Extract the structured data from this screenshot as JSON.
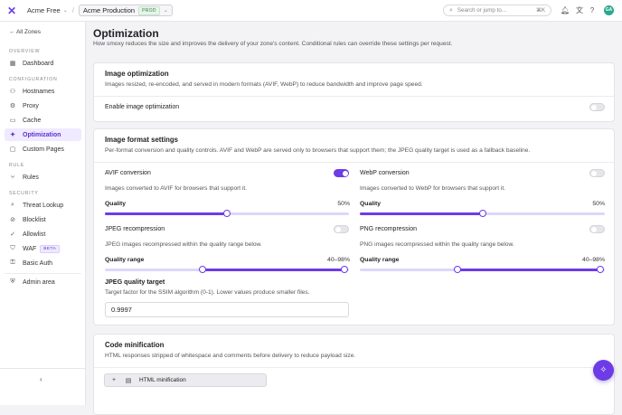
{
  "topbar": {
    "org": "Acme Free",
    "zone": "Acme Production",
    "zone_badge": "PROD",
    "search_placeholder": "Search or jump to...",
    "search_shortcut": "⌘K",
    "avatar": "GA"
  },
  "sidebar": {
    "back": "All Zones",
    "sections": {
      "overview": "OVERVIEW",
      "configuration": "CONFIGURATION",
      "rule": "RULE",
      "security": "SECURITY"
    },
    "items": [
      {
        "label": "Dashboard",
        "icon": "dashboard-icon"
      },
      {
        "label": "Hostnames",
        "icon": "hostnames-icon"
      },
      {
        "label": "Proxy",
        "icon": "proxy-icon"
      },
      {
        "label": "Cache",
        "icon": "cache-icon"
      },
      {
        "label": "Optimization",
        "icon": "optimization-icon",
        "active": true
      },
      {
        "label": "Custom Pages",
        "icon": "custom-pages-icon"
      },
      {
        "label": "Rules",
        "icon": "rules-icon"
      },
      {
        "label": "Threat Lookup",
        "icon": "threat-lookup-icon"
      },
      {
        "label": "Blocklist",
        "icon": "blocklist-icon"
      },
      {
        "label": "Allowlist",
        "icon": "allowlist-icon"
      },
      {
        "label": "WAF",
        "icon": "waf-icon",
        "badge": "BETA"
      },
      {
        "label": "Basic Auth",
        "icon": "basic-auth-icon"
      },
      {
        "label": "Admin area",
        "icon": "admin-area-icon"
      }
    ]
  },
  "page": {
    "title": "Optimization",
    "subtitle": "How smoxy reduces the size and improves the delivery of your zone's content. Conditional rules can override these settings per request."
  },
  "image_optimization": {
    "title": "Image optimization",
    "description": "Images resized, re-encoded, and served in modern formats (AVIF, WebP) to reduce bandwidth and improve page speed.",
    "enable_label": "Enable image optimization",
    "enabled": false
  },
  "image_format": {
    "title": "Image format settings",
    "description": "Per-format conversion and quality controls. AVIF and WebP are served only to browsers that support them; the JPEG quality target is used as a fallback baseline.",
    "avif": {
      "label": "AVIF conversion",
      "enabled": true,
      "description": "Images converted to AVIF for browsers that support it.",
      "quality_label": "Quality",
      "quality_value": "50%",
      "quality": 50
    },
    "webp": {
      "label": "WebP conversion",
      "enabled": false,
      "description": "Images converted to WebP for browsers that support it.",
      "quality_label": "Quality",
      "quality_value": "50%",
      "quality": 50
    },
    "jpeg": {
      "label": "JPEG recompression",
      "enabled": false,
      "description": "JPEG images recompressed within the quality range below.",
      "range_label": "Quality range",
      "range_value": "40–98%",
      "min": 40,
      "max": 98
    },
    "png": {
      "label": "PNG recompression",
      "enabled": false,
      "description": "PNG images recompressed within the quality range below.",
      "range_label": "Quality range",
      "range_value": "40–98%",
      "min": 40,
      "max": 98
    },
    "jpeg_target": {
      "label": "JPEG quality target",
      "description": "Target factor for the SSIM algorithm (0-1). Lower values produce smaller files.",
      "value": "0.9997"
    }
  },
  "code_minification": {
    "title": "Code minification",
    "description": "HTML responses stripped of whitespace and comments before delivery to reduce payload size.",
    "html_label": "HTML minification"
  }
}
